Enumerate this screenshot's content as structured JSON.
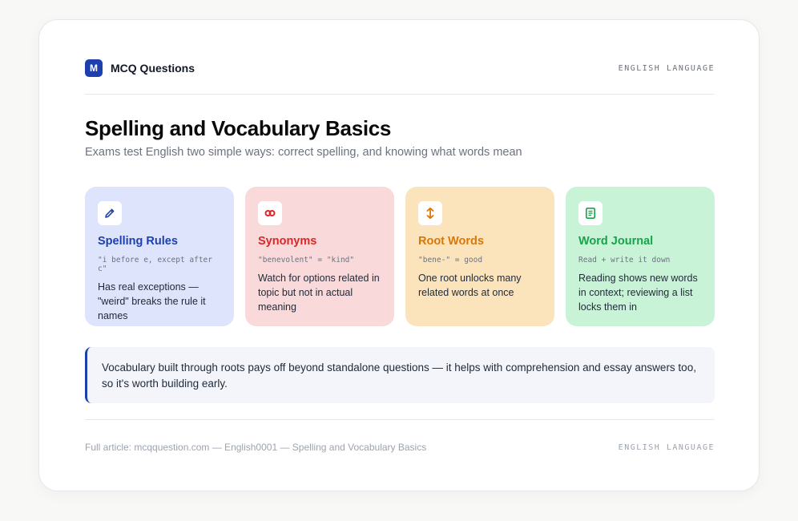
{
  "header": {
    "logo_letter": "M",
    "brand": "MCQ Questions",
    "category": "ENGLISH LANGUAGE"
  },
  "main": {
    "title": "Spelling and Vocabulary Basics",
    "subtitle": "Exams test English two simple ways: correct spelling, and knowing what words mean"
  },
  "tiles": [
    {
      "title": "Spelling Rules",
      "example": "\"i before e, except after c\"",
      "description": "Has real exceptions — \"weird\" breaks the rule it names",
      "icon": "pencil-icon",
      "bg": "#dde4fb",
      "accent": "#1e40af"
    },
    {
      "title": "Synonyms",
      "example": "\"benevolent\" = \"kind\"",
      "description": "Watch for options related in topic but not in actual meaning",
      "icon": "link-icon",
      "bg": "#f9d9d9",
      "accent": "#dc2626"
    },
    {
      "title": "Root Words",
      "example": "\"bene-\" = good",
      "description": "One root unlocks many related words at once",
      "icon": "expand-arrows-icon",
      "bg": "#fbe4bc",
      "accent": "#d97706"
    },
    {
      "title": "Word Journal",
      "example": "Read + write it down",
      "description": "Reading shows new words in context; reviewing a list locks them in",
      "icon": "journal-icon",
      "bg": "#c9f3d7",
      "accent": "#16a34a"
    }
  ],
  "callout": {
    "text": "Vocabulary built through roots pays off beyond standalone questions — it helps with comprehension and essay answers too, so it's worth building early."
  },
  "footer": {
    "link_text": "Full article: mcqquestion.com — English0001 — Spelling and Vocabulary Basics",
    "category": "ENGLISH LANGUAGE"
  }
}
